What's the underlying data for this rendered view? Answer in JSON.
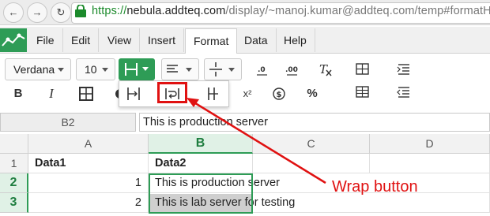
{
  "browser": {
    "url_scheme": "https://",
    "url_host": "nebula.addteq.com",
    "url_path": "/display/~manoj.kumar@addteq.com/temp#formatHo"
  },
  "menu": {
    "items": [
      "File",
      "Edit",
      "View",
      "Insert",
      "Format",
      "Data",
      "Help"
    ],
    "active": "Format"
  },
  "toolbar": {
    "font_family": "Verdana",
    "font_size": "10",
    "bold_label": "B",
    "italic_label": "I",
    "superscript_label": "x²",
    "currency_label": "$",
    "percent_label": "%"
  },
  "formula_bar": {
    "cell_ref": "B2",
    "value": "This is production server"
  },
  "sheet": {
    "columns": [
      "A",
      "B",
      "C",
      "D"
    ],
    "selected_column": "B",
    "rows": [
      {
        "num": "1",
        "cells": [
          "Data1",
          "Data2",
          "",
          ""
        ]
      },
      {
        "num": "2",
        "cells": [
          "1",
          "This is production server",
          "",
          ""
        ]
      },
      {
        "num": "3",
        "cells": [
          "2",
          "This is lab server for testing",
          "",
          ""
        ]
      }
    ]
  },
  "annotation": {
    "label": "Wrap button",
    "color": "#e01111"
  },
  "colors": {
    "accent": "#2e9c56",
    "highlight": "#e01111"
  }
}
